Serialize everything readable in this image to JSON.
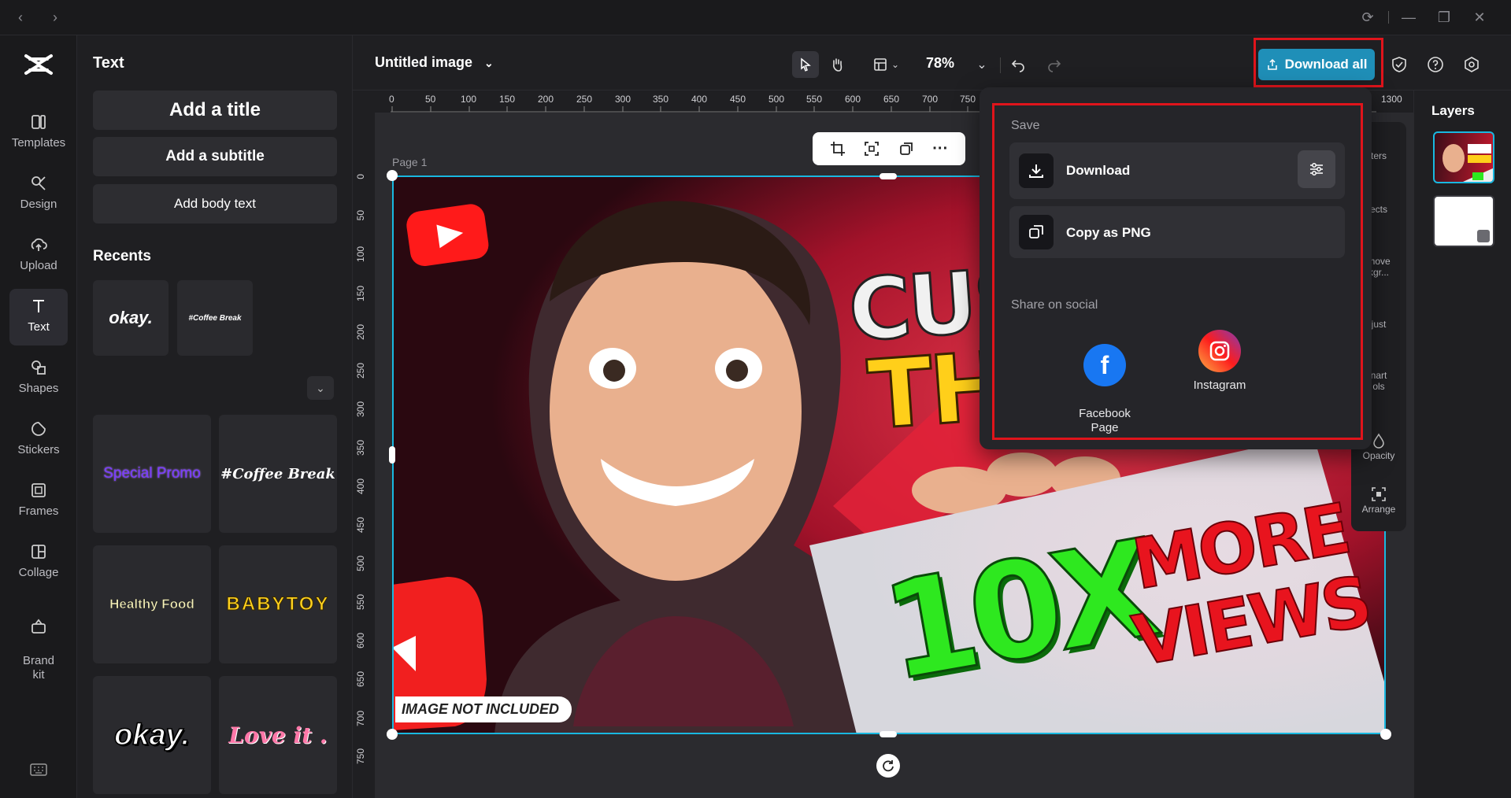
{
  "window": {
    "back": "‹",
    "forward": "›",
    "reload": "⟳",
    "minimize": "—",
    "restore": "❐",
    "close": "✕"
  },
  "rail": [
    {
      "label": "Templates",
      "icon": "templates-icon"
    },
    {
      "label": "Design",
      "icon": "design-icon"
    },
    {
      "label": "Upload",
      "icon": "upload-icon"
    },
    {
      "label": "Text",
      "icon": "text-icon"
    },
    {
      "label": "Shapes",
      "icon": "shapes-icon"
    },
    {
      "label": "Stickers",
      "icon": "stickers-icon"
    },
    {
      "label": "Frames",
      "icon": "frames-icon"
    },
    {
      "label": "Collage",
      "icon": "collage-icon"
    },
    {
      "label": "Brand\nkit",
      "icon": "brand-kit-icon"
    }
  ],
  "panel": {
    "title": "Text",
    "add_title": "Add a title",
    "add_subtitle": "Add a subtitle",
    "add_body": "Add body text",
    "recents": "Recents",
    "recent_items": [
      "okay.",
      "#Coffee Break"
    ],
    "styles": [
      "Special Promo",
      "#Coffee Break",
      "Healthy Food",
      "BABYTOY",
      "okay.",
      "Love it ."
    ]
  },
  "topbar": {
    "doc_title": "Untitled image",
    "zoom": "78%",
    "download_all": "Download all"
  },
  "canvas": {
    "page_label": "Page 1",
    "ruler_x": [
      "0",
      "50",
      "100",
      "150",
      "200",
      "250",
      "300",
      "350",
      "400",
      "450",
      "500",
      "550",
      "600",
      "650",
      "700",
      "750",
      "1300"
    ],
    "ruler_y": [
      "0",
      "50",
      "100",
      "150",
      "200",
      "250",
      "300",
      "350",
      "400",
      "450",
      "500",
      "550",
      "600",
      "650",
      "700",
      "750"
    ],
    "image_text": {
      "headline_1": "CUST",
      "headline_2": "TH",
      "card_1": "10X",
      "card_2": "MORE",
      "card_3": "VIEWS",
      "badge": "IMAGE NOT INCLUDED"
    }
  },
  "right_tools": [
    {
      "label": "ters",
      "icon": "filters-icon"
    },
    {
      "label": "ects",
      "icon": "effects-icon"
    },
    {
      "label": "move\nkgr...",
      "icon": "remove-background-icon"
    },
    {
      "label": "just",
      "icon": "adjust-icon"
    },
    {
      "label": "nart\nols",
      "icon": "smart-tools-icon"
    },
    {
      "label": "Opacity",
      "icon": "opacity-icon"
    },
    {
      "label": "Arrange",
      "icon": "arrange-icon"
    }
  ],
  "layers": {
    "title": "Layers"
  },
  "popover": {
    "save_heading": "Save",
    "download": "Download",
    "copy_png": "Copy as PNG",
    "share_heading": "Share on social",
    "facebook": "Facebook\nPage",
    "instagram": "Instagram"
  },
  "colors": {
    "accent": "#1f8fb8",
    "highlight": "#e0141b",
    "selection": "#19b8e0"
  }
}
